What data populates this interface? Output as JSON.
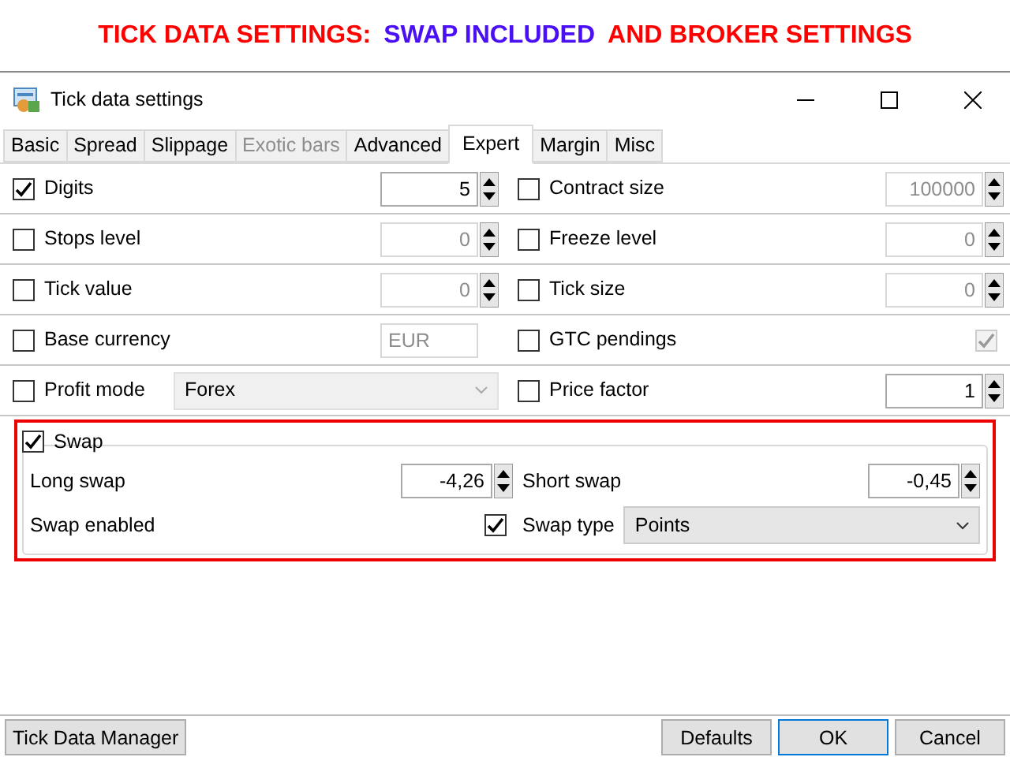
{
  "banner": [
    {
      "text": "TICK DATA SETTINGS:",
      "color": "#ff0000"
    },
    {
      "text": "SWAP INCLUDED",
      "color": "#4a0ff5"
    },
    {
      "text": "AND BROKER SETTINGS",
      "color": "#ff0000"
    }
  ],
  "window": {
    "title": "Tick data settings"
  },
  "tabs": [
    {
      "label": "Basic",
      "selected": false,
      "disabled": false
    },
    {
      "label": "Spread",
      "selected": false,
      "disabled": false
    },
    {
      "label": "Slippage",
      "selected": false,
      "disabled": false
    },
    {
      "label": "Exotic bars",
      "selected": false,
      "disabled": true
    },
    {
      "label": "Advanced",
      "selected": false,
      "disabled": false
    },
    {
      "label": "Expert",
      "selected": true,
      "disabled": false
    },
    {
      "label": "Margin",
      "selected": false,
      "disabled": false
    },
    {
      "label": "Misc",
      "selected": false,
      "disabled": false
    }
  ],
  "settings": [
    {
      "label": "Digits",
      "checked": true,
      "kind": "spin",
      "value": "5",
      "disabled": false
    },
    {
      "label": "Contract size",
      "checked": false,
      "kind": "spin",
      "value": "100000",
      "disabled": true
    },
    {
      "label": "Stops level",
      "checked": false,
      "kind": "spin",
      "value": "0",
      "disabled": true
    },
    {
      "label": "Freeze level",
      "checked": false,
      "kind": "spin",
      "value": "0",
      "disabled": true
    },
    {
      "label": "Tick value",
      "checked": false,
      "kind": "spin",
      "value": "0",
      "disabled": true
    },
    {
      "label": "Tick size",
      "checked": false,
      "kind": "spin",
      "value": "0",
      "disabled": true
    },
    {
      "label": "Base currency",
      "checked": false,
      "kind": "text",
      "value": "EUR",
      "disabled": true
    },
    {
      "label": "GTC pendings",
      "checked": false,
      "kind": "check",
      "on": true,
      "disabled": true
    },
    {
      "label": "Profit mode",
      "checked": false,
      "kind": "combo",
      "value": "Forex",
      "disabled": true
    },
    {
      "label": "Price factor",
      "checked": false,
      "kind": "spin",
      "value": "1",
      "disabled": false
    }
  ],
  "swap": {
    "label": "Swap",
    "checked": true,
    "highlighted": true,
    "long_swap": {
      "label": "Long swap",
      "value": "-4,26"
    },
    "short_swap": {
      "label": "Short swap",
      "value": "-0,45"
    },
    "swap_enabled": {
      "label": "Swap enabled",
      "checked": true
    },
    "swap_type": {
      "label": "Swap type",
      "value": "Points"
    }
  },
  "footer": {
    "left": [
      {
        "label": "Tick Data Manager",
        "default": false
      }
    ],
    "right": [
      {
        "label": "Defaults",
        "default": false
      },
      {
        "label": "OK",
        "default": true
      },
      {
        "label": "Cancel",
        "default": false
      }
    ]
  }
}
